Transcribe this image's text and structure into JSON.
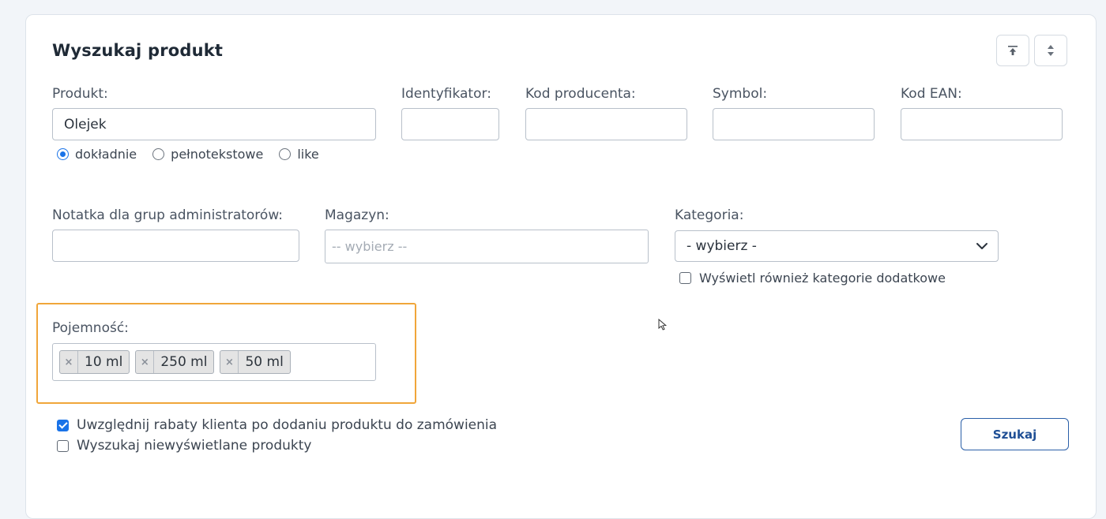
{
  "panel": {
    "title": "Wyszukaj produkt"
  },
  "icons": {
    "collapse_top": "arrow-to-top-icon",
    "sort": "sort-updown-icon",
    "cursor": "mouse-pointer-icon"
  },
  "fields": {
    "produkt_label": "Produkt:",
    "produkt_value": "Olejek",
    "identyfikator_label": "Identyfikator:",
    "kod_producenta_label": "Kod producenta:",
    "symbol_label": "Symbol:",
    "kod_ean_label": "Kod EAN:",
    "notatka_label": "Notatka dla grup administratorów:",
    "magazyn_label": "Magazyn:",
    "magazyn_placeholder": "-- wybierz --",
    "kategoria_label": "Kategoria:",
    "kategoria_selected": "- wybierz -",
    "pojemnosc_label": "Pojemność:"
  },
  "match_mode": {
    "options": [
      "dokładnie",
      "pełnotekstowe",
      "like"
    ],
    "selected": "dokładnie"
  },
  "kategoria_extra": {
    "label": "Wyświetl również kategorie dodatkowe",
    "checked": false
  },
  "pojemnosc_tags": [
    "10 ml",
    "250 ml",
    "50 ml"
  ],
  "tag_remove_symbol": "×",
  "options": {
    "rabaty_label": "Uwzględnij rabaty klienta po dodaniu produktu do zamówienia",
    "rabaty_checked": true,
    "niewyswietlane_label": "Wyszukaj niewyświetlane produkty",
    "niewyswietlane_checked": false
  },
  "actions": {
    "search_label": "Szukaj"
  },
  "colors": {
    "accent": "#1a73e8",
    "highlight_border": "#f0a63a",
    "button_border": "#2a5fa8"
  }
}
